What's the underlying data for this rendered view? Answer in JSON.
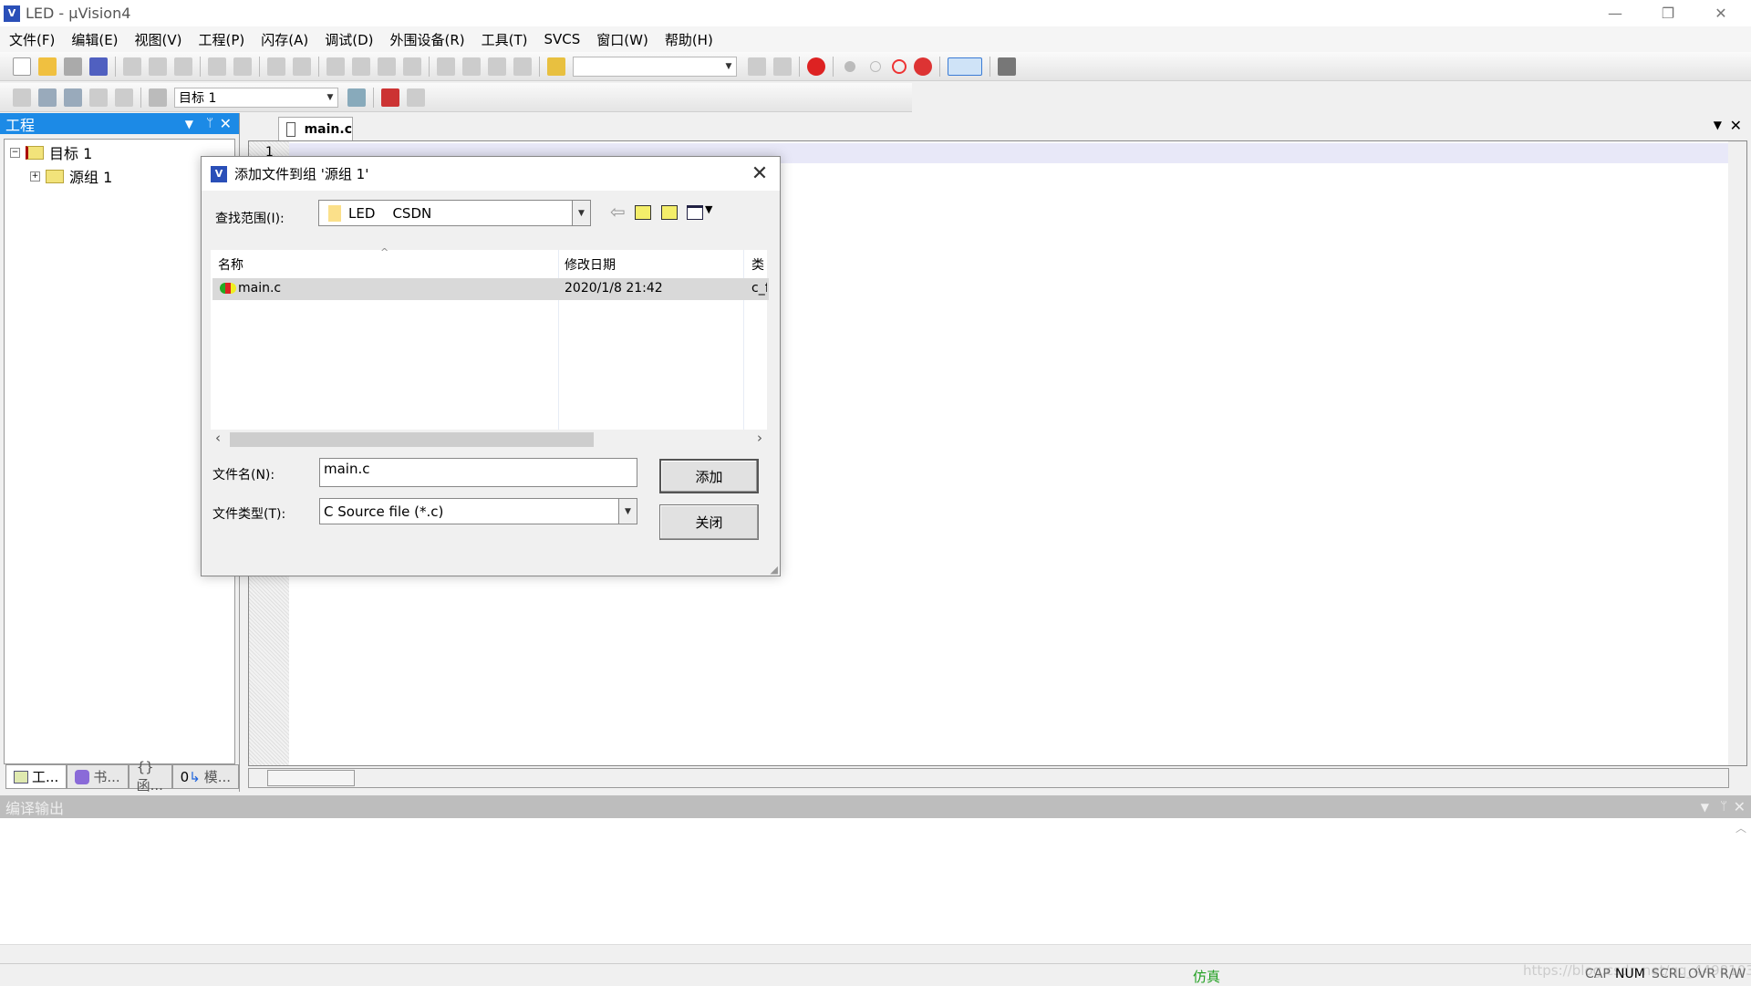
{
  "window": {
    "title": "LED  - µVision4",
    "app_icon": "uvision-icon",
    "controls": [
      "minimize",
      "restore",
      "close"
    ]
  },
  "menu": [
    "文件(F)",
    "编辑(E)",
    "视图(V)",
    "工程(P)",
    "闪存(A)",
    "调试(D)",
    "外围设备(R)",
    "工具(T)",
    "SVCS",
    "窗口(W)",
    "帮助(H)"
  ],
  "toolbar2": {
    "target_select": "目标 1"
  },
  "project_panel": {
    "title": "工程",
    "tree": [
      {
        "label": "目标 1",
        "expanded": true
      },
      {
        "label": "源组 1",
        "expanded": false
      }
    ],
    "tabs": [
      "工...",
      "书...",
      "{} 函...",
      "模..."
    ]
  },
  "editor": {
    "tab": "main.c",
    "line_number": "1"
  },
  "output_panel": {
    "title": "编译输出"
  },
  "status": {
    "mode": "仿真",
    "mode_color": "#22a022",
    "indicators": [
      "CAP",
      "NUM",
      "SCRL",
      "OVR",
      "R/W"
    ],
    "watermark": "https://blog.csdn.net/qq_44981039"
  },
  "dialog": {
    "title": "添加文件到组 '源组 1'",
    "look_in_label": "查找范围(I):",
    "look_in_value": "LED    CSDN",
    "columns": [
      "名称",
      "修改日期",
      "类"
    ],
    "files": [
      {
        "name": "main.c",
        "date": "2020/1/8 21:42",
        "type": "c_f"
      }
    ],
    "filename_label": "文件名(N):",
    "filename_value": "main.c",
    "filetype_label": "文件类型(T):",
    "filetype_value": "C Source file (*.c)",
    "add_button": "添加",
    "close_button": "关闭"
  }
}
